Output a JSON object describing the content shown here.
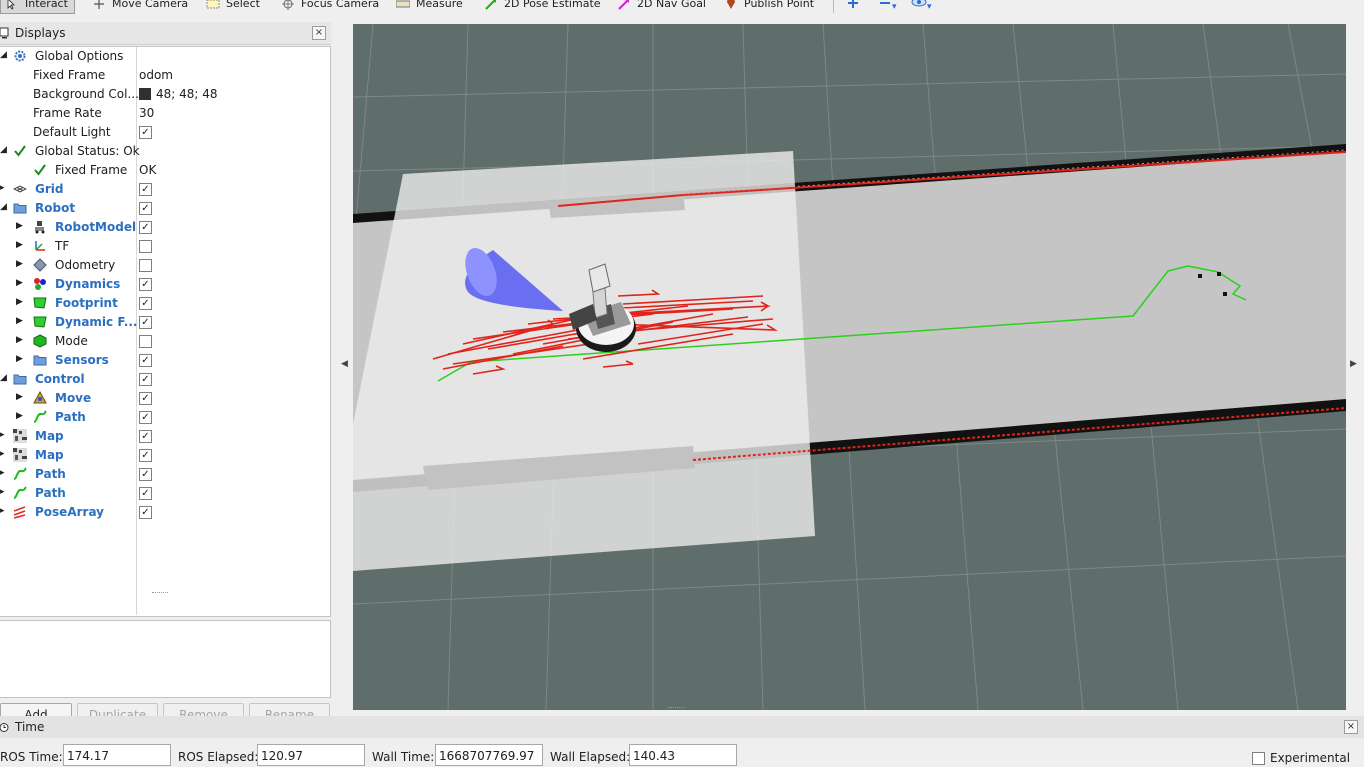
{
  "toolbar": {
    "interact": "Interact",
    "move_camera": "Move Camera",
    "select": "Select",
    "focus_camera": "Focus Camera",
    "measure": "Measure",
    "pose_estimate": "2D Pose Estimate",
    "nav_goal": "2D Nav Goal",
    "publish_point": "Publish Point"
  },
  "displays": {
    "title": "Displays",
    "close": "×",
    "rows": [
      {
        "label": "Global Options",
        "value": ""
      },
      {
        "label": "Fixed Frame",
        "value": "odom"
      },
      {
        "label": "Background Col...",
        "value": "48; 48; 48"
      },
      {
        "label": "Frame Rate",
        "value": "30"
      },
      {
        "label": "Default Light",
        "value": "✓"
      },
      {
        "label": "Global Status: Ok",
        "value": ""
      },
      {
        "label": "Fixed Frame",
        "value": "OK"
      },
      {
        "label": "Grid",
        "value": "✓"
      },
      {
        "label": "Robot",
        "value": "✓"
      },
      {
        "label": "RobotModel",
        "value": "✓"
      },
      {
        "label": "TF",
        "value": ""
      },
      {
        "label": "Odometry",
        "value": ""
      },
      {
        "label": "Dynamics",
        "value": "✓"
      },
      {
        "label": "Footprint",
        "value": "✓"
      },
      {
        "label": "Dynamic F...",
        "value": "✓"
      },
      {
        "label": "Mode",
        "value": ""
      },
      {
        "label": "Sensors",
        "value": "✓"
      },
      {
        "label": "Control",
        "value": "✓"
      },
      {
        "label": "Move",
        "value": "✓"
      },
      {
        "label": "Path",
        "value": "✓"
      },
      {
        "label": "Map",
        "value": "✓"
      },
      {
        "label": "Map",
        "value": "✓"
      },
      {
        "label": "Path",
        "value": "✓"
      },
      {
        "label": "Path",
        "value": "✓"
      },
      {
        "label": "PoseArray",
        "value": "✓"
      }
    ],
    "buttons": {
      "add": "Add",
      "duplicate": "Duplicate",
      "remove": "Remove",
      "rename": "Rename"
    }
  },
  "time": {
    "title": "Time",
    "close": "×",
    "ros_time_label": "ROS Time:",
    "ros_time": "174.17",
    "ros_elapsed_label": "ROS Elapsed:",
    "ros_elapsed": "120.97",
    "wall_time_label": "Wall Time:",
    "wall_time": "1668707769.97",
    "wall_elapsed_label": "Wall Elapsed:",
    "wall_elapsed": "140.43",
    "experimental": "Experimental"
  },
  "colors": {
    "viewport_bg": "#5f6e6b",
    "accent_label": "#2c6fc0",
    "laser_red": "#e0241b",
    "path_green": "#2ccf1f",
    "sensor_cone": "#6666ee"
  }
}
